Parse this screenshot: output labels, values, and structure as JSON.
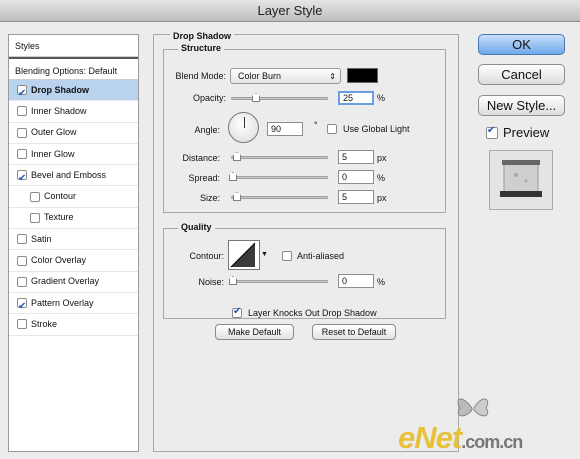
{
  "window": {
    "title": "Layer Style"
  },
  "styles_list": {
    "header": "Styles",
    "blending": "Blending Options: Default",
    "items": [
      {
        "label": "Drop Shadow",
        "checked": true,
        "active": true
      },
      {
        "label": "Inner Shadow",
        "checked": false
      },
      {
        "label": "Outer Glow",
        "checked": false
      },
      {
        "label": "Inner Glow",
        "checked": false
      },
      {
        "label": "Bevel and Emboss",
        "checked": true
      },
      {
        "label": "Contour",
        "checked": false
      },
      {
        "label": "Texture",
        "checked": false
      },
      {
        "label": "Satin",
        "checked": false
      },
      {
        "label": "Color Overlay",
        "checked": false
      },
      {
        "label": "Gradient Overlay",
        "checked": false
      },
      {
        "label": "Pattern Overlay",
        "checked": true
      },
      {
        "label": "Stroke",
        "checked": false
      }
    ]
  },
  "panel": {
    "title": "Drop Shadow",
    "structure": {
      "title": "Structure",
      "blend_mode_label": "Blend Mode:",
      "blend_mode_value": "Color Burn",
      "color": "#000000",
      "opacity_label": "Opacity:",
      "opacity_value": "25",
      "opacity_unit": "%",
      "angle_label": "Angle:",
      "angle_value": "90",
      "angle_unit": "°",
      "global_light_label": "Use Global Light",
      "distance_label": "Distance:",
      "distance_value": "5",
      "distance_unit": "px",
      "spread_label": "Spread:",
      "spread_value": "0",
      "spread_unit": "%",
      "size_label": "Size:",
      "size_value": "5",
      "size_unit": "px"
    },
    "quality": {
      "title": "Quality",
      "contour_label": "Contour:",
      "anti_aliased_label": "Anti-aliased",
      "noise_label": "Noise:",
      "noise_value": "0",
      "noise_unit": "%"
    },
    "knockout_label": "Layer Knocks Out Drop Shadow",
    "make_default": "Make Default",
    "reset_default": "Reset to Default"
  },
  "actions": {
    "ok": "OK",
    "cancel": "Cancel",
    "new_style": "New Style...",
    "preview_label": "Preview"
  },
  "watermark": {
    "brand": "eNet",
    "suffix": ".com.cn"
  },
  "colors": {
    "accent": "#6fa8ea",
    "selection": "#b9d3ee",
    "watermark": "#e8c13c"
  }
}
